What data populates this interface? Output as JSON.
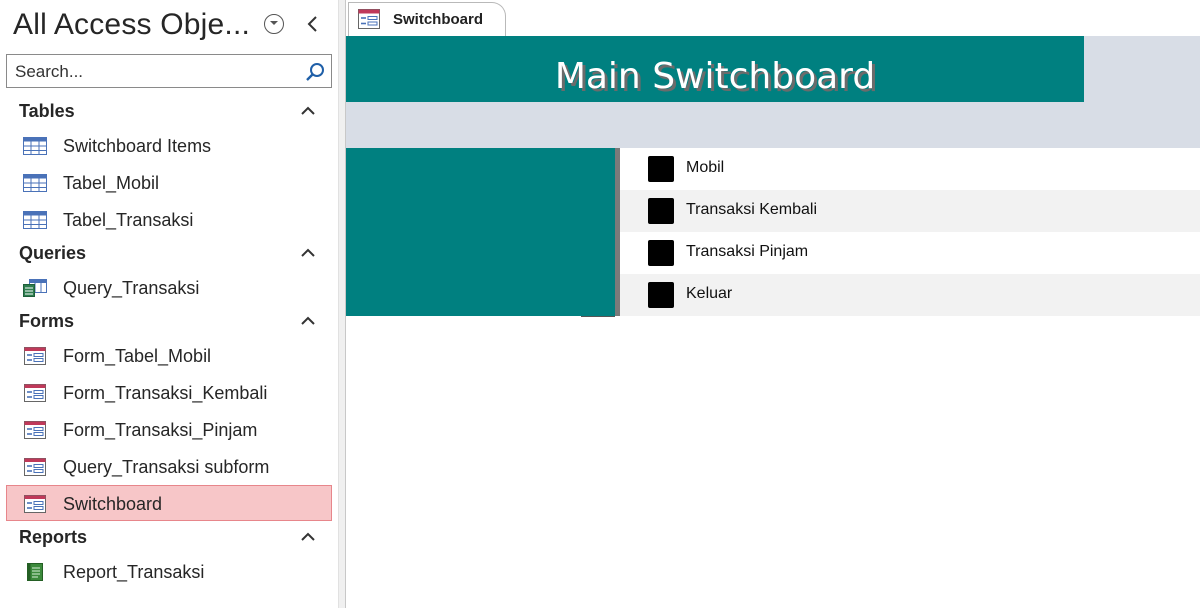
{
  "nav": {
    "title": "All Access Obje...",
    "search": {
      "placeholder": "Search..."
    },
    "groups": [
      {
        "label": "Tables",
        "items": [
          "Switchboard Items",
          "Tabel_Mobil",
          "Tabel_Transaksi"
        ]
      },
      {
        "label": "Queries",
        "items": [
          "Query_Transaksi"
        ]
      },
      {
        "label": "Forms",
        "items": [
          "Form_Tabel_Mobil",
          "Form_Transaksi_Kembali",
          "Form_Transaksi_Pinjam",
          "Query_Transaksi subform",
          "Switchboard"
        ]
      },
      {
        "label": "Reports",
        "items": [
          "Report_Transaksi"
        ]
      }
    ],
    "selected_item": "Switchboard"
  },
  "document": {
    "tab_label": "Switchboard",
    "form_title": "Main Switchboard",
    "items": [
      "Mobil",
      "Transaksi Kembali",
      "Transaksi Pinjam",
      "Keluar"
    ]
  },
  "icons": {
    "table": "table-icon",
    "query": "query-icon",
    "form": "form-icon",
    "report": "report-icon",
    "search": "search-icon",
    "collapse": "chevron-left-icon",
    "group_toggle": "chevron-up-icon",
    "menu": "dropdown-circle-icon"
  },
  "colors": {
    "accent_teal": "#008080",
    "header_band": "#d8dde6",
    "selection": "#f7c6c8",
    "selection_border": "#e7868b"
  }
}
